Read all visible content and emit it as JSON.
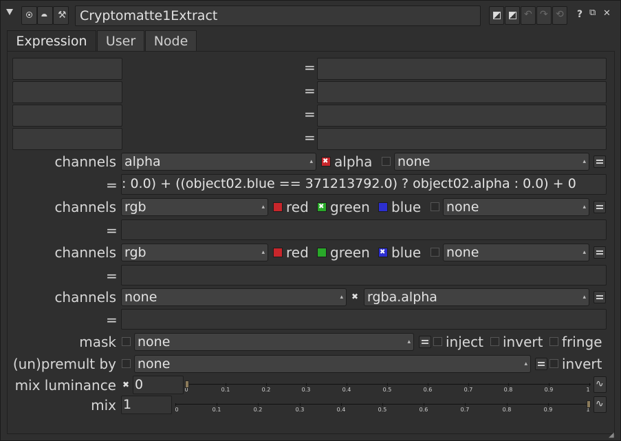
{
  "window": {
    "title": "Cryptomatte1Extract",
    "buttons": {
      "help": "?",
      "float": "⧉",
      "close": "✕"
    }
  },
  "tabs": [
    "Expression",
    "User",
    "Node"
  ],
  "temp_rows": {
    "count_label": "",
    "eq": "="
  },
  "channels1": {
    "label": "channels",
    "menu": "alpha",
    "alpha_label": "alpha",
    "extra_menu": "none",
    "expr_eq": "=",
    "expression": ": 0.0) + ((object02.blue == 371213792.0) ? object02.alpha : 0.0) + 0"
  },
  "channels2": {
    "label": "channels",
    "menu": "rgb",
    "red": "red",
    "green": "green",
    "blue": "blue",
    "extra_menu": "none",
    "expr_eq": "="
  },
  "channels3": {
    "label": "channels",
    "menu": "rgb",
    "red": "red",
    "green": "green",
    "blue": "blue",
    "extra_menu": "none",
    "expr_eq": "="
  },
  "channels4": {
    "label": "channels",
    "menu": "none",
    "second_menu": "rgba.alpha",
    "expr_eq": "="
  },
  "mask": {
    "label": "mask",
    "menu": "none",
    "inject": "inject",
    "invert": "invert",
    "fringe": "fringe"
  },
  "premult": {
    "label": "(un)premult by",
    "menu": "none",
    "invert": "invert"
  },
  "mix_luminance": {
    "label": "mix luminance",
    "value": "0",
    "level": 0.0
  },
  "mix": {
    "label": "mix",
    "value": "1",
    "level": 1.0
  },
  "slider_ticks": [
    "0",
    "0.1",
    "0.2",
    "0.3",
    "0.4",
    "0.5",
    "0.6",
    "0.7",
    "0.8",
    "0.9",
    "1"
  ],
  "colors": {
    "red": "#c8262b",
    "green": "#29a829",
    "blue": "#2c2fd0",
    "alpha_red": "#c8262b"
  }
}
